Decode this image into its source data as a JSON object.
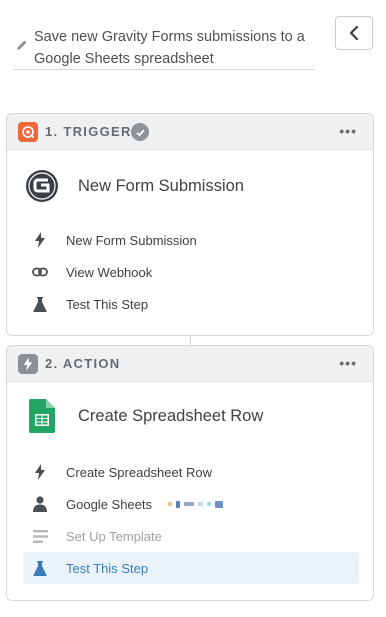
{
  "zap": {
    "title": "Save new Gravity Forms submissions to a Google Sheets spreadsheet"
  },
  "trigger": {
    "step_label": "1. TRIGGER",
    "app_title": "New Form Submission",
    "items": [
      {
        "label": "New Form Submission",
        "icon": "bolt-icon"
      },
      {
        "label": "View Webhook",
        "icon": "link-icon"
      },
      {
        "label": "Test This Step",
        "icon": "flask-icon"
      }
    ]
  },
  "action": {
    "step_label": "2. ACTION",
    "app_title": "Create Spreadsheet Row",
    "items": [
      {
        "label": "Create Spreadsheet Row",
        "icon": "bolt-icon"
      },
      {
        "label": "Google Sheets",
        "icon": "user-icon"
      },
      {
        "label": "Set Up Template",
        "icon": "template-icon"
      },
      {
        "label": "Test This Step",
        "icon": "flask-icon"
      }
    ]
  },
  "colors": {
    "trigger_badge": "#f0683a",
    "action_badge": "#8a9095",
    "active_item_bg": "#eaf3fb",
    "active_item_text": "#3b7bb8",
    "sheets_green": "#23a566"
  }
}
